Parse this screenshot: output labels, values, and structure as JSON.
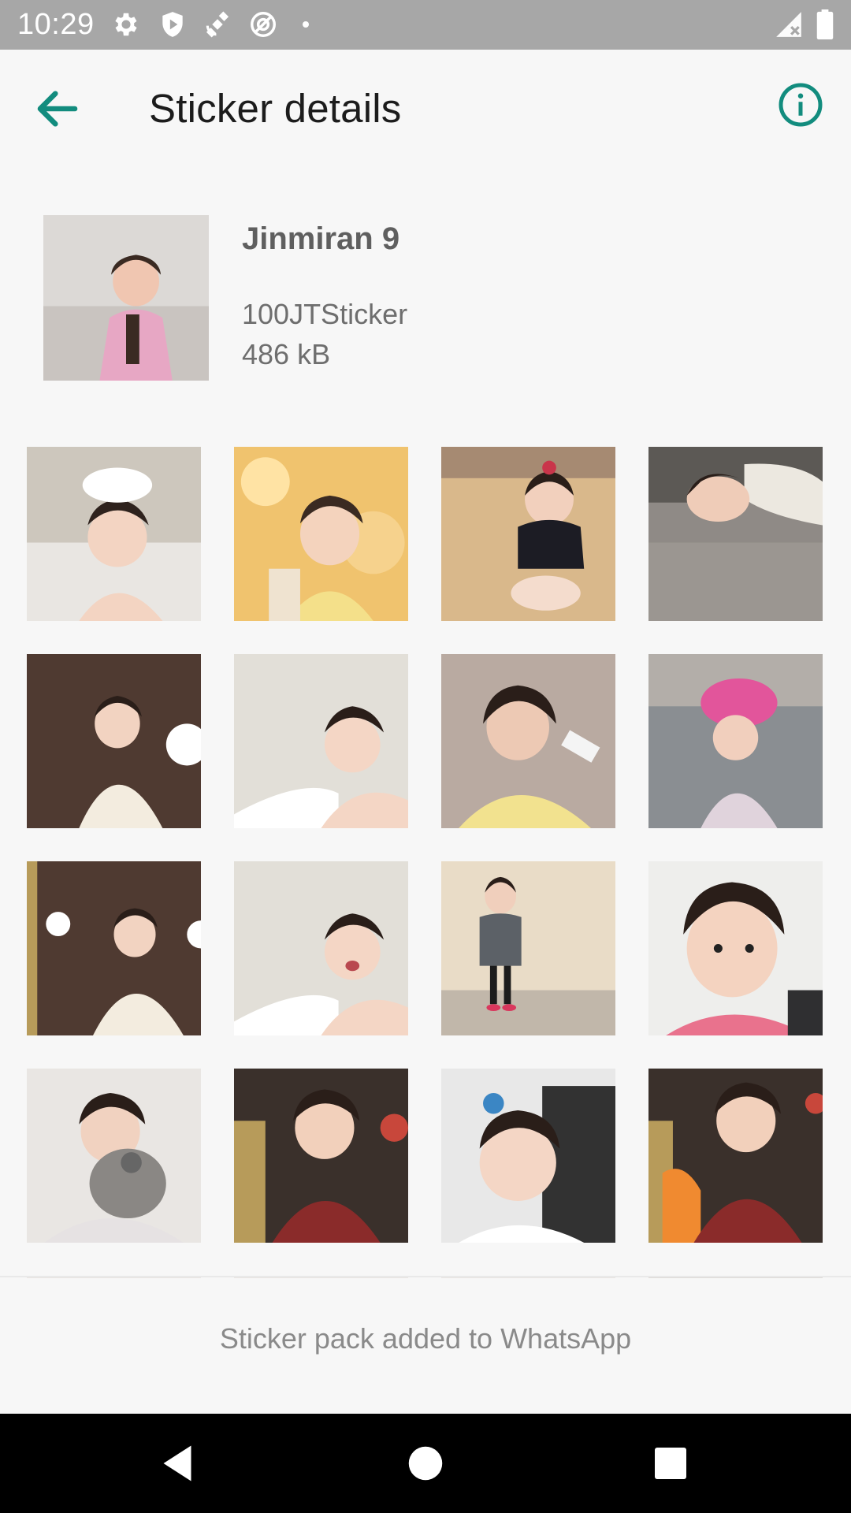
{
  "status_bar": {
    "time": "10:29",
    "icons_left": [
      "gear-icon",
      "shield-play-icon",
      "satellite-icon",
      "at-sign-icon",
      "dot-icon"
    ],
    "icons_right": [
      "signal-off-icon",
      "battery-icon"
    ]
  },
  "app_bar": {
    "title": "Sticker details",
    "back_icon": "arrow-left-icon",
    "info_icon": "info-circle-icon",
    "accent_color": "#128c7e"
  },
  "pack": {
    "name": "Jinmiran 9",
    "publisher": "100JTSticker",
    "size": "486 kB"
  },
  "stickers": [
    {
      "subject": "baby in bath with foam on head"
    },
    {
      "subject": "baby in hanbok with hair ornament"
    },
    {
      "subject": "baby sitting on floor holding foot"
    },
    {
      "subject": "baby sleeping on bed"
    },
    {
      "subject": "baby in white dress with headband"
    },
    {
      "subject": "baby laughing in bathtub"
    },
    {
      "subject": "baby in yellow shirt holding bottle"
    },
    {
      "subject": "baby wearing pink towel hat"
    },
    {
      "subject": "baby in white dress with headband"
    },
    {
      "subject": "baby laughing in bathtub"
    },
    {
      "subject": "toddler standing in gray outfit"
    },
    {
      "subject": "baby in pink shirt close-up"
    },
    {
      "subject": "baby hugging plush koala"
    },
    {
      "subject": "baby with pigtails in red sweater"
    },
    {
      "subject": "baby in white top on chair"
    },
    {
      "subject": "baby with pigtails finger in mouth"
    }
  ],
  "footer": {
    "status": "Sticker pack added to WhatsApp"
  },
  "nav_bar": {
    "back": "triangle-back-icon",
    "home": "circle-home-icon",
    "recents": "square-recents-icon"
  }
}
